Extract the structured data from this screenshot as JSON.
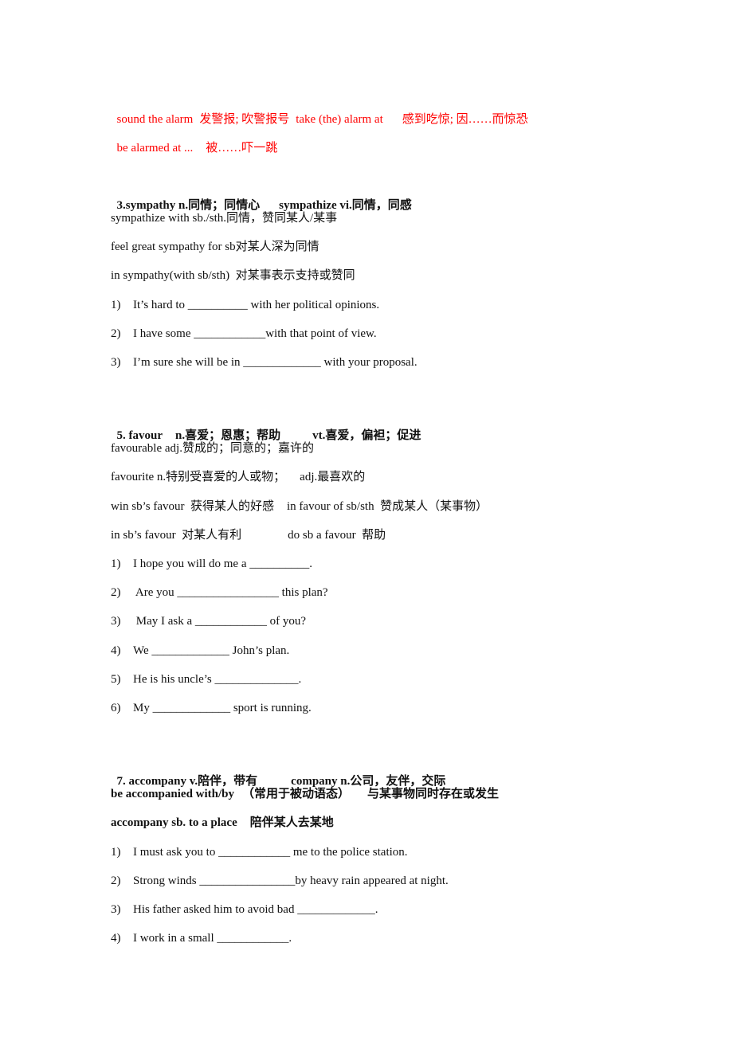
{
  "alarm_notes": {
    "line1": {
      "phrase1": "sound the alarm",
      "meaning1": "发警报; 吹警报号",
      "phrase2": "take (the) alarm at",
      "meaning2": "感到吃惊; 因……而惊恐"
    },
    "line2": {
      "phrase": "be alarmed at ...",
      "meaning": "被……吓一跳"
    },
    "accent_color": "#ff0000"
  },
  "section3": {
    "heading_part1": "3.sympathy n.同情；同情心",
    "heading_part2": "sympathize vi.同情，同感",
    "notes": [
      "sympathize with sb./sth.同情，赞同某人/某事",
      "feel great sympathy for sb对某人深为同情",
      "in sympathy(with sb/sth)  对某事表示支持或赞同"
    ],
    "exercises": [
      {
        "num": "1)",
        "text": "It’s hard to __________ with her political opinions."
      },
      {
        "num": "2)",
        "text": "I have some ____________with that point of view."
      },
      {
        "num": "3)",
        "text": "I’m sure she will be in _____________ with your proposal."
      }
    ]
  },
  "section5": {
    "heading_part1": "5. favour",
    "heading_part2": "n.喜爱；恩惠；帮助",
    "heading_part3": "vt.喜爱，偏袒；促进",
    "notes": [
      {
        "a": "favourable adj.赞成的；同意的；嘉许的",
        "b": ""
      },
      {
        "a": "favourite n.特别受喜爱的人或物；",
        "b": "adj.最喜欢的"
      },
      {
        "a": "win sb’s favour  获得某人的好感",
        "b": "in favour of sb/sth  赞成某人（某事物）"
      },
      {
        "a": "in sb’s favour  对某人有利",
        "b": "do sb a favour  帮助"
      }
    ],
    "exercises": [
      {
        "num": "1)",
        "text": "I hope you will do me a __________."
      },
      {
        "num": "2)",
        "text": " Are you _________________ this plan?"
      },
      {
        "num": "3)",
        "text": " May I ask a ____________ of you?"
      },
      {
        "num": "4)",
        "text": "We _____________ John’s plan."
      },
      {
        "num": "5)",
        "text": "He is his uncle’s ______________."
      },
      {
        "num": "6)",
        "text": "My _____________ sport is running."
      }
    ]
  },
  "section7": {
    "heading_part1": "7. accompany v.陪伴，带有",
    "heading_part2": "company n.公司，友伴，交际",
    "notes": [
      {
        "a": "be accompanied with/by",
        "b": "（常用于被动语态）",
        "c": "与某事物同时存在或发生"
      },
      {
        "a": "accompany sb. to a place",
        "b": "陪伴某人去某地",
        "c": ""
      }
    ],
    "exercises": [
      {
        "num": "1)",
        "text": "I must ask you to ____________ me to the police station."
      },
      {
        "num": "2)",
        "text": "Strong winds ________________by heavy rain appeared at night."
      },
      {
        "num": "3)",
        "text": "His father asked him to avoid bad _____________."
      },
      {
        "num": "4)",
        "text": "I work in a small ____________."
      }
    ]
  }
}
